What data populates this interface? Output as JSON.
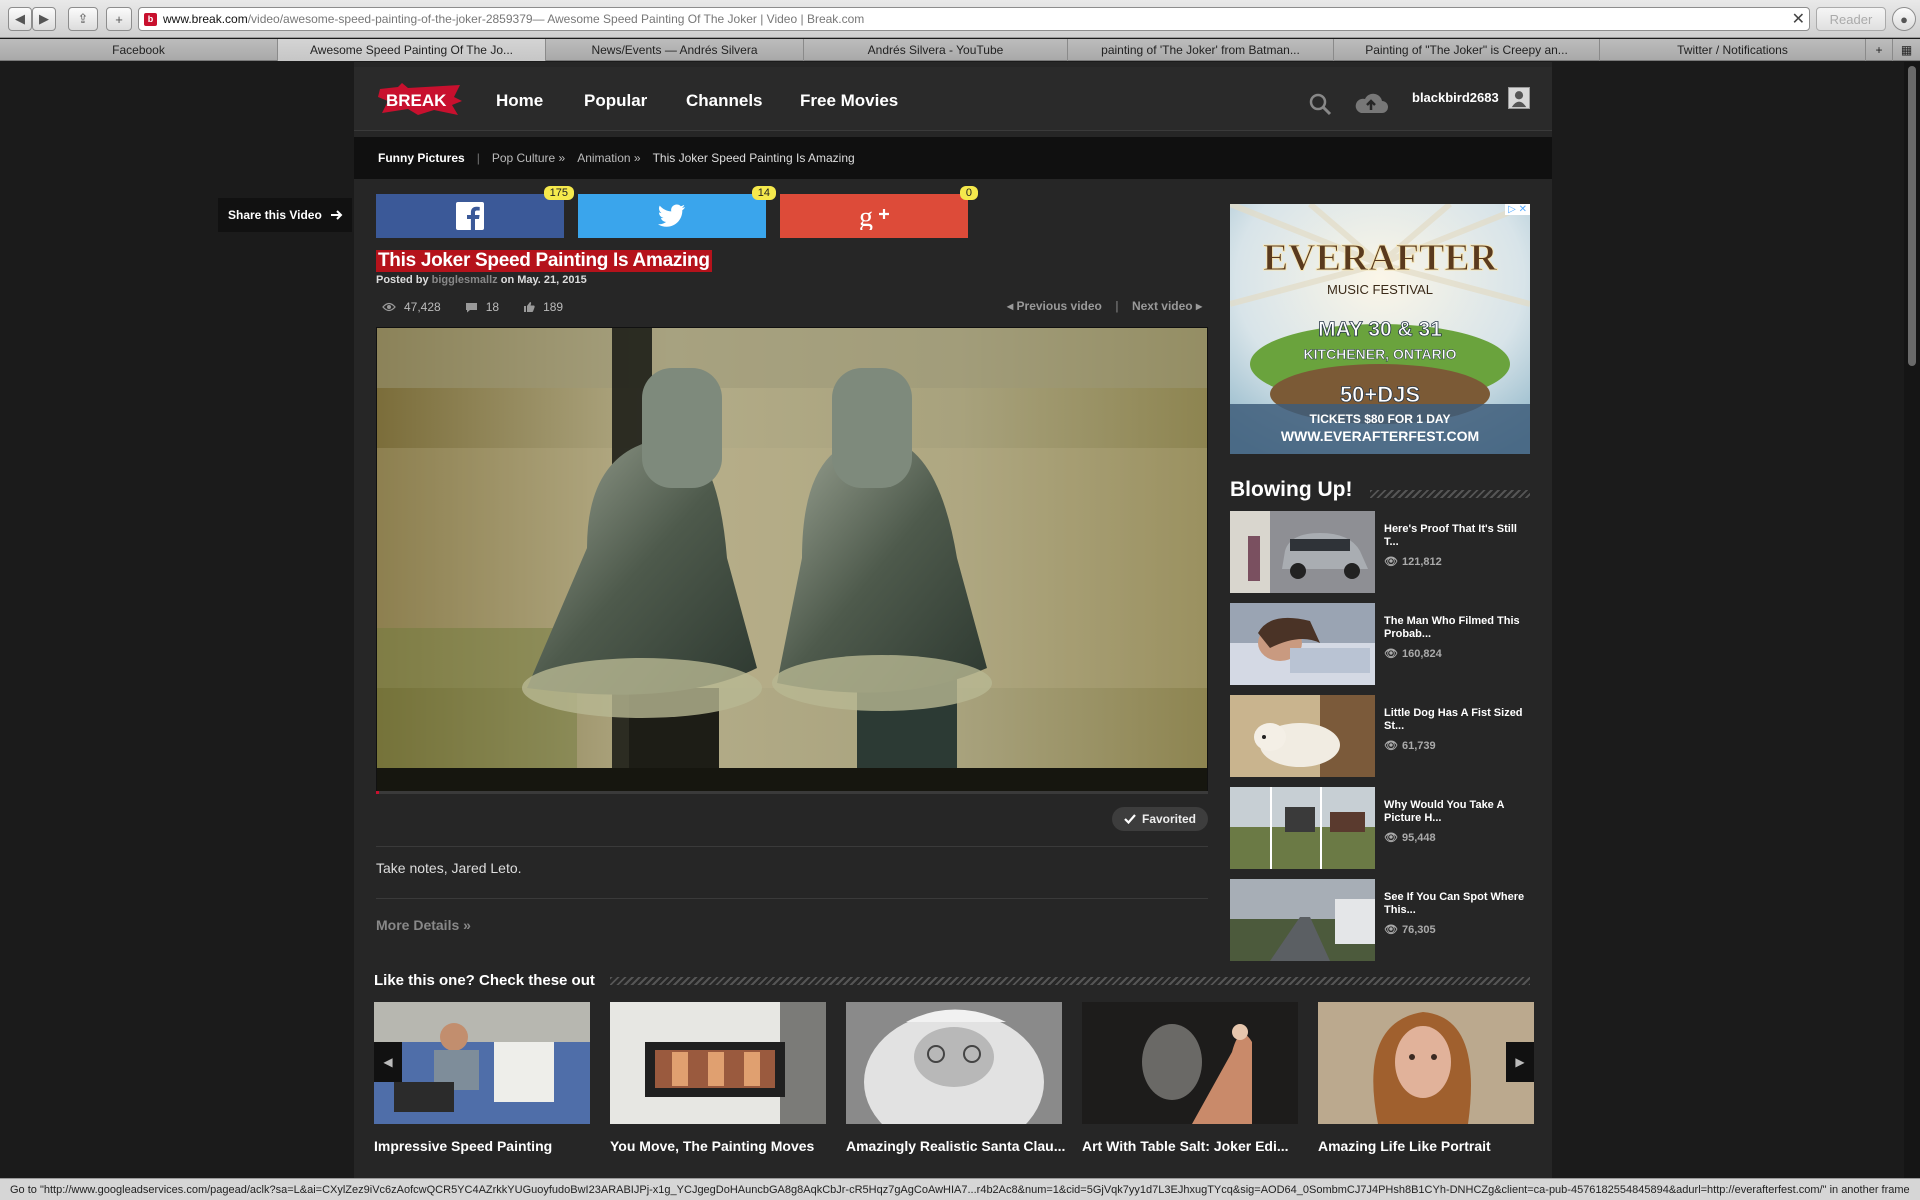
{
  "browser": {
    "url_host": "www.break.com",
    "url_path": "/video/awesome-speed-painting-of-the-joker-2859379",
    "url_title": " — Awesome Speed Painting Of The Joker | Video | Break.com",
    "reader_label": "Reader",
    "tabs": [
      {
        "label": "Facebook"
      },
      {
        "label": "Awesome Speed Painting Of The Jo..."
      },
      {
        "label": "News/Events — Andrés Silvera"
      },
      {
        "label": "Andrés Silvera - YouTube"
      },
      {
        "label": "painting of 'The Joker' from Batman..."
      },
      {
        "label": "Painting of \"The Joker\" is Creepy an..."
      },
      {
        "label": "Twitter / Notifications"
      }
    ],
    "status_text": "Go to \"http://www.googleadservices.com/pagead/aclk?sa=L&ai=CXylZez9iVc6zAofcwQCR5YC4AZrkkYUGuoyfudoBwI23ARABIJPj-x1g_YCJgegDoHAuncbGA8g8AqkCbJr-cR5Hqz7gAgCoAwHIA7...r4b2Ac8&num=1&cid=5GjVqk7yy1d7L3EJhxugTYcq&sig=AOD64_0SombmCJ7J4PHsh8B1CYh-DNHCZg&client=ca-pub-4576182554845894&adurl=http://everafterfest.com/\" in another frame"
  },
  "site": {
    "logo_text": "BREAK",
    "nav": [
      "Home",
      "Popular",
      "Channels",
      "Free Movies"
    ],
    "username": "blackbird2683",
    "breadcrumbs": [
      "Funny Pictures",
      "Pop Culture »",
      "Animation »",
      "This Joker Speed Painting Is Amazing"
    ]
  },
  "share": {
    "label": "Share this Video",
    "facebook_count": "175",
    "twitter_count": "14",
    "gplus_count": "0"
  },
  "video": {
    "title": "This Joker Speed Painting Is Amazing",
    "posted_prefix": "Posted by",
    "author": "bigglesmallz",
    "date": "on May. 21, 2015",
    "views": "47,428",
    "comments": "18",
    "likes": "189",
    "prev_label": "Previous video",
    "next_label": "Next video",
    "progress": 0.004,
    "favorited_label": "Favorited",
    "description": "Take notes, Jared Leto.",
    "more_details": "More Details »"
  },
  "ad": {
    "title1": "EVERAFTER",
    "title2": "MUSIC FESTIVAL",
    "dates": "MAY 30 & 31",
    "location": "KITCHENER, ONTARIO",
    "djs": "50+DJS",
    "tickets": "TICKETS $80 FOR 1 DAY",
    "url": "WWW.EVERAFTERFEST.COM"
  },
  "sidebar": {
    "title": "Blowing Up!",
    "items": [
      {
        "title": "Here's Proof That It's Still T...",
        "views": "121,812"
      },
      {
        "title": "The Man Who Filmed This Probab...",
        "views": "160,824"
      },
      {
        "title": "Little Dog Has A Fist Sized St...",
        "views": "61,739"
      },
      {
        "title": "Why Would You Take A Picture H...",
        "views": "95,448"
      },
      {
        "title": "See If You Can Spot Where This...",
        "views": "76,305"
      }
    ]
  },
  "related": {
    "title": "Like this one? Check these out",
    "items": [
      {
        "title": "Impressive Speed Painting"
      },
      {
        "title": "You Move, The Painting Moves"
      },
      {
        "title": "Amazingly Realistic Santa Clau..."
      },
      {
        "title": "Art With Table Salt: Joker Edi..."
      },
      {
        "title": "Amazing Life Like Portrait"
      }
    ]
  },
  "colors": {
    "brand_red": "#c8102e",
    "facebook": "#3b5998",
    "twitter": "#3aa5ec",
    "gplus": "#dd4b39"
  }
}
